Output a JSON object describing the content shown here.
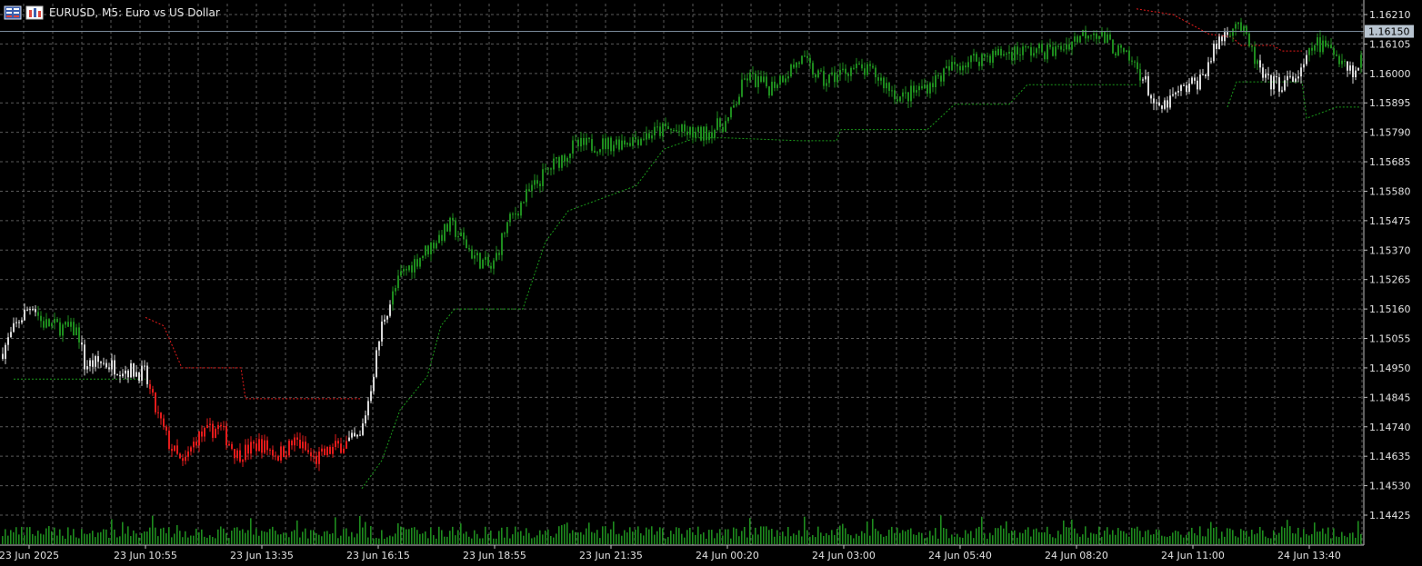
{
  "header": {
    "title": "EURUSD, M5:  Euro vs US Dollar",
    "icons": [
      "table-icon",
      "chart-bars-icon"
    ]
  },
  "colors": {
    "background": "#000000",
    "grid": "#5a5a5a",
    "bull": "#1e8c1e",
    "bear": "#e31b1b",
    "neutral": "#d9d9d9",
    "volume": "#1e8c1e",
    "stop_green": "#1a9a1a",
    "stop_red": "#e31b1b",
    "current_price_line": "#7a8a9a",
    "current_price_tag": "#b8c4d0"
  },
  "chart_data": {
    "type": "candlestick",
    "symbol": "EURUSD",
    "timeframe": "M5",
    "y_ticks": [
      "1.16210",
      "1.16105",
      "1.16000",
      "1.15895",
      "1.15790",
      "1.15685",
      "1.15580",
      "1.15475",
      "1.15370",
      "1.15265",
      "1.15160",
      "1.15055",
      "1.14950",
      "1.14845",
      "1.14740",
      "1.14635",
      "1.14530",
      "1.14425"
    ],
    "ylim": [
      1.1439,
      1.1625
    ],
    "current_price": "1.16150",
    "x_ticks": [
      "23 Jun 2025",
      "23 Jun 10:55",
      "23 Jun 13:35",
      "23 Jun 16:15",
      "23 Jun 18:55",
      "23 Jun 21:35",
      "24 Jun 00:20",
      "24 Jun 03:00",
      "24 Jun 05:40",
      "24 Jun 08:20",
      "24 Jun 11:00",
      "24 Jun 13:40"
    ],
    "price_path": [
      [
        0,
        1.15,
        "neutral"
      ],
      [
        20,
        1.1512,
        "neutral"
      ],
      [
        35,
        1.1518,
        "neutral"
      ],
      [
        45,
        1.1511,
        "bull"
      ],
      [
        85,
        1.1508,
        "bull"
      ],
      [
        92,
        1.1496,
        "neutral"
      ],
      [
        110,
        1.1497,
        "neutral"
      ],
      [
        130,
        1.1495,
        "neutral"
      ],
      [
        158,
        1.1493,
        "neutral"
      ],
      [
        170,
        1.148,
        "bear"
      ],
      [
        185,
        1.1468,
        "bear"
      ],
      [
        200,
        1.146,
        "bear"
      ],
      [
        215,
        1.147,
        "bear"
      ],
      [
        240,
        1.1474,
        "bear"
      ],
      [
        260,
        1.1464,
        "bear"
      ],
      [
        285,
        1.1468,
        "bear"
      ],
      [
        305,
        1.1464,
        "bear"
      ],
      [
        325,
        1.1469,
        "bear"
      ],
      [
        345,
        1.1462,
        "bear"
      ],
      [
        370,
        1.1467,
        "bear"
      ],
      [
        395,
        1.147,
        "neutral"
      ],
      [
        405,
        1.1485,
        "neutral"
      ],
      [
        420,
        1.1512,
        "neutral"
      ],
      [
        440,
        1.1528,
        "bull"
      ],
      [
        465,
        1.1536,
        "bull"
      ],
      [
        495,
        1.1546,
        "bull"
      ],
      [
        520,
        1.1535,
        "bull"
      ],
      [
        540,
        1.153,
        "bull"
      ],
      [
        555,
        1.1545,
        "bull"
      ],
      [
        575,
        1.1555,
        "bull"
      ],
      [
        600,
        1.1565,
        "bull"
      ],
      [
        630,
        1.1574,
        "bull"
      ],
      [
        670,
        1.1575,
        "bull"
      ],
      [
        700,
        1.1577,
        "bull"
      ],
      [
        730,
        1.158,
        "bull"
      ],
      [
        770,
        1.1578,
        "bull"
      ],
      [
        800,
        1.1583,
        "bull"
      ],
      [
        820,
        1.1599,
        "bull"
      ],
      [
        845,
        1.1595,
        "bull"
      ],
      [
        880,
        1.1605,
        "bull"
      ],
      [
        905,
        1.1597,
        "bull"
      ],
      [
        935,
        1.1602,
        "bull"
      ],
      [
        960,
        1.16,
        "bull"
      ],
      [
        990,
        1.1591,
        "bull"
      ],
      [
        1020,
        1.1596,
        "bull"
      ],
      [
        1050,
        1.1603,
        "bull"
      ],
      [
        1080,
        1.1606,
        "bull"
      ],
      [
        1120,
        1.1608,
        "bull"
      ],
      [
        1160,
        1.1608,
        "bull"
      ],
      [
        1200,
        1.1616,
        "bull"
      ],
      [
        1225,
        1.1609,
        "bull"
      ],
      [
        1250,
        1.1602,
        "bull"
      ],
      [
        1260,
        1.1596,
        "neutral"
      ],
      [
        1272,
        1.1586,
        "neutral"
      ],
      [
        1295,
        1.1593,
        "neutral"
      ],
      [
        1320,
        1.1598,
        "neutral"
      ],
      [
        1340,
        1.1612,
        "neutral"
      ],
      [
        1360,
        1.1619,
        "bull"
      ],
      [
        1375,
        1.1608,
        "bull"
      ],
      [
        1390,
        1.1597,
        "neutral"
      ],
      [
        1410,
        1.1596,
        "neutral"
      ],
      [
        1430,
        1.16,
        "neutral"
      ],
      [
        1445,
        1.1611,
        "bull"
      ],
      [
        1470,
        1.1607,
        "bull"
      ],
      [
        1490,
        1.16,
        "neutral"
      ],
      [
        1497,
        1.1606,
        "bull"
      ]
    ],
    "stop_line_green_1": [
      [
        15,
        1.1491
      ],
      [
        160,
        1.1491
      ]
    ],
    "stop_line_red_1": [
      [
        160,
        1.1513
      ],
      [
        180,
        1.151
      ],
      [
        200,
        1.1495
      ],
      [
        265,
        1.1495
      ],
      [
        270,
        1.1484
      ],
      [
        398,
        1.1484
      ]
    ],
    "stop_line_green_2": [
      [
        398,
        1.1452
      ],
      [
        420,
        1.1462
      ],
      [
        440,
        1.148
      ],
      [
        470,
        1.1492
      ],
      [
        485,
        1.151
      ],
      [
        500,
        1.1516
      ],
      [
        540,
        1.1516
      ],
      [
        575,
        1.1516
      ],
      [
        600,
        1.154
      ],
      [
        625,
        1.1551
      ],
      [
        700,
        1.156
      ],
      [
        730,
        1.1573
      ],
      [
        765,
        1.1577
      ],
      [
        800,
        1.1577
      ],
      [
        880,
        1.1576
      ],
      [
        920,
        1.1576
      ],
      [
        925,
        1.158
      ],
      [
        1020,
        1.158
      ],
      [
        1050,
        1.1589
      ],
      [
        1110,
        1.1589
      ],
      [
        1130,
        1.1596
      ],
      [
        1250,
        1.1596
      ]
    ],
    "stop_line_red_2": [
      [
        1250,
        1.1623
      ],
      [
        1290,
        1.1621
      ],
      [
        1330,
        1.1614
      ],
      [
        1355,
        1.1613
      ],
      [
        1365,
        1.161
      ],
      [
        1400,
        1.161
      ],
      [
        1410,
        1.1608
      ],
      [
        1432,
        1.1608
      ]
    ],
    "stop_line_green_3": [
      [
        1350,
        1.1588
      ],
      [
        1360,
        1.1597
      ],
      [
        1432,
        1.1597
      ],
      [
        1437,
        1.1584
      ],
      [
        1470,
        1.1588
      ],
      [
        1497,
        1.1588
      ]
    ]
  }
}
